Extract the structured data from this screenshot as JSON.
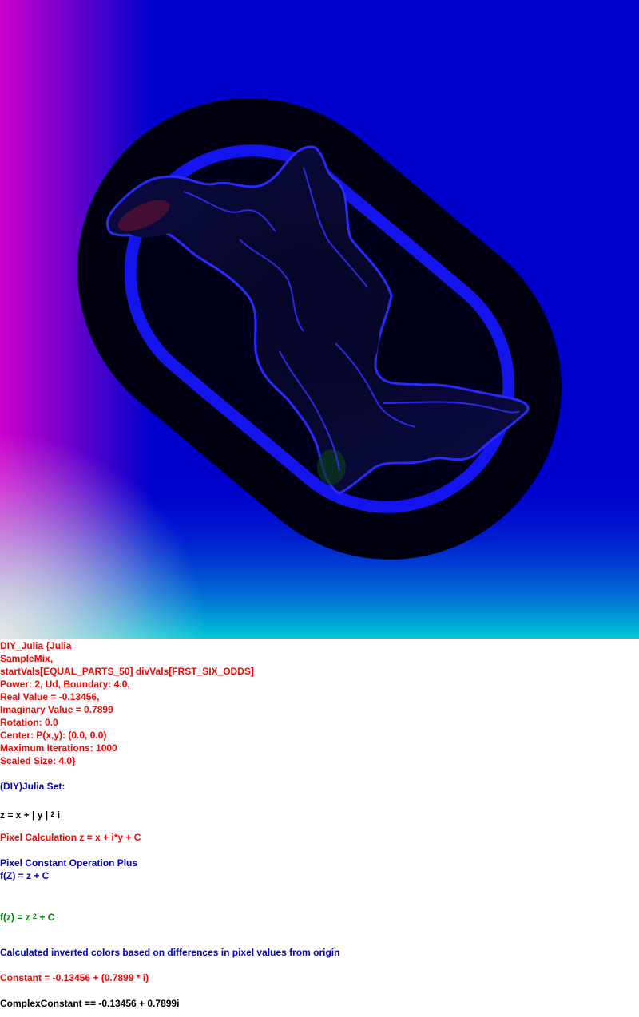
{
  "image": {
    "description_icon": "julia-fractal-image",
    "colors": {
      "bg_left": "#cc00cc",
      "bg_center": "#0000cc",
      "bg_bottom": "#00cccc",
      "ring": "#000010",
      "band": "#1a1aff",
      "core": "#06062a"
    }
  },
  "params": {
    "line1": "DIY_Julia {Julia",
    "line2": "SampleMix,",
    "line3": "startVals[EQUAL_PARTS_50] divVals[FRST_SIX_ODDS]",
    "line4": "Power: 2, Ud, Boundary: 4.0,",
    "line5": "Real Value = -0.13456,",
    "line6": "Imaginary Value = 0.7899",
    "line7": "Rotation: 0.0",
    "line8": "Center: P(x,y): (0.0, 0.0)",
    "line9": "Maximum Iterations: 1000",
    "line10": "Scaled Size: 4.0}"
  },
  "formula": {
    "title": "(DIY)Julia Set:",
    "z_prefix": "z = x + | y | ",
    "z_exp": "2",
    "z_suffix": " i",
    "pixel_calc": "Pixel Calculation z = x + i*y + C",
    "op_title": "Pixel Constant Operation Plus",
    "op_formula": "f(Z) = z + C",
    "fz_prefix": "f(z) = z ",
    "fz_exp": "2",
    "fz_suffix": " + C",
    "colors_note": "Calculated inverted colors based on differences in pixel values from origin",
    "constant": "Constant = -0.13456 + (0.7899 * i)",
    "complex_constant": "ComplexConstant == -0.13456 + 0.7899i"
  }
}
